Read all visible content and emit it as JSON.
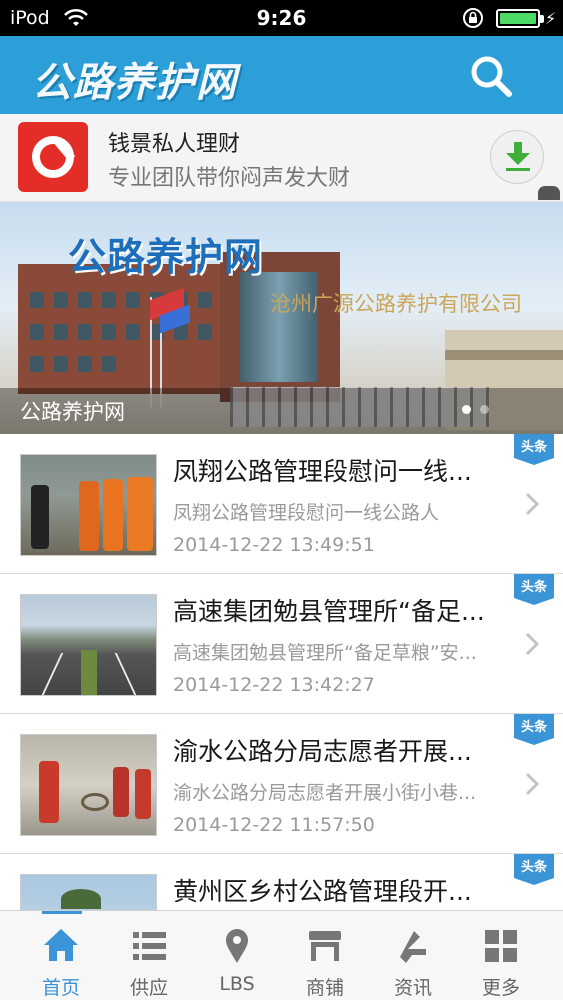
{
  "status_bar": {
    "carrier": "iPod",
    "time": "9:26",
    "battery_level": 1.0
  },
  "header": {
    "logo_text": "公路养护网",
    "search_icon": "search-icon"
  },
  "ad": {
    "title": "钱景私人理财",
    "subtitle": "专业团队带你闷声发大财",
    "download_icon": "download-icon"
  },
  "hero": {
    "logo_text": "公路养护网",
    "company_text": "沧州广源公路养护有限公司",
    "caption": "公路养护网",
    "slide_count": 2,
    "active_slide": 1
  },
  "colors": {
    "header_blue": "#2d9fd8",
    "accent_blue": "#3a94d6",
    "ad_red": "#e52d27"
  },
  "news": [
    {
      "title": "凤翔公路管理段慰问一线...",
      "summary": "凤翔公路管理段慰问一线公路人",
      "date": "2014-12-22 13:49:51",
      "tag": "头条"
    },
    {
      "title": "高速集团勉县管理所“备足...",
      "summary": "高速集团勉县管理所“备足草粮”安...",
      "date": "2014-12-22 13:42:27",
      "tag": "头条"
    },
    {
      "title": "渝水公路分局志愿者开展...",
      "summary": "渝水公路分局志愿者开展小街小巷...",
      "date": "2014-12-22 11:57:50",
      "tag": "头条"
    },
    {
      "title": "黄州区乡村公路管理段开...",
      "summary": "",
      "date": "",
      "tag": "头条"
    }
  ],
  "tabs": [
    {
      "label": "首页",
      "icon": "home-icon",
      "active": true
    },
    {
      "label": "供应",
      "icon": "list-icon",
      "active": false
    },
    {
      "label": "LBS",
      "icon": "map-pin-icon",
      "active": false
    },
    {
      "label": "商铺",
      "icon": "shop-icon",
      "active": false
    },
    {
      "label": "资讯",
      "icon": "news-icon",
      "active": false
    },
    {
      "label": "更多",
      "icon": "grid-icon",
      "active": false
    }
  ]
}
